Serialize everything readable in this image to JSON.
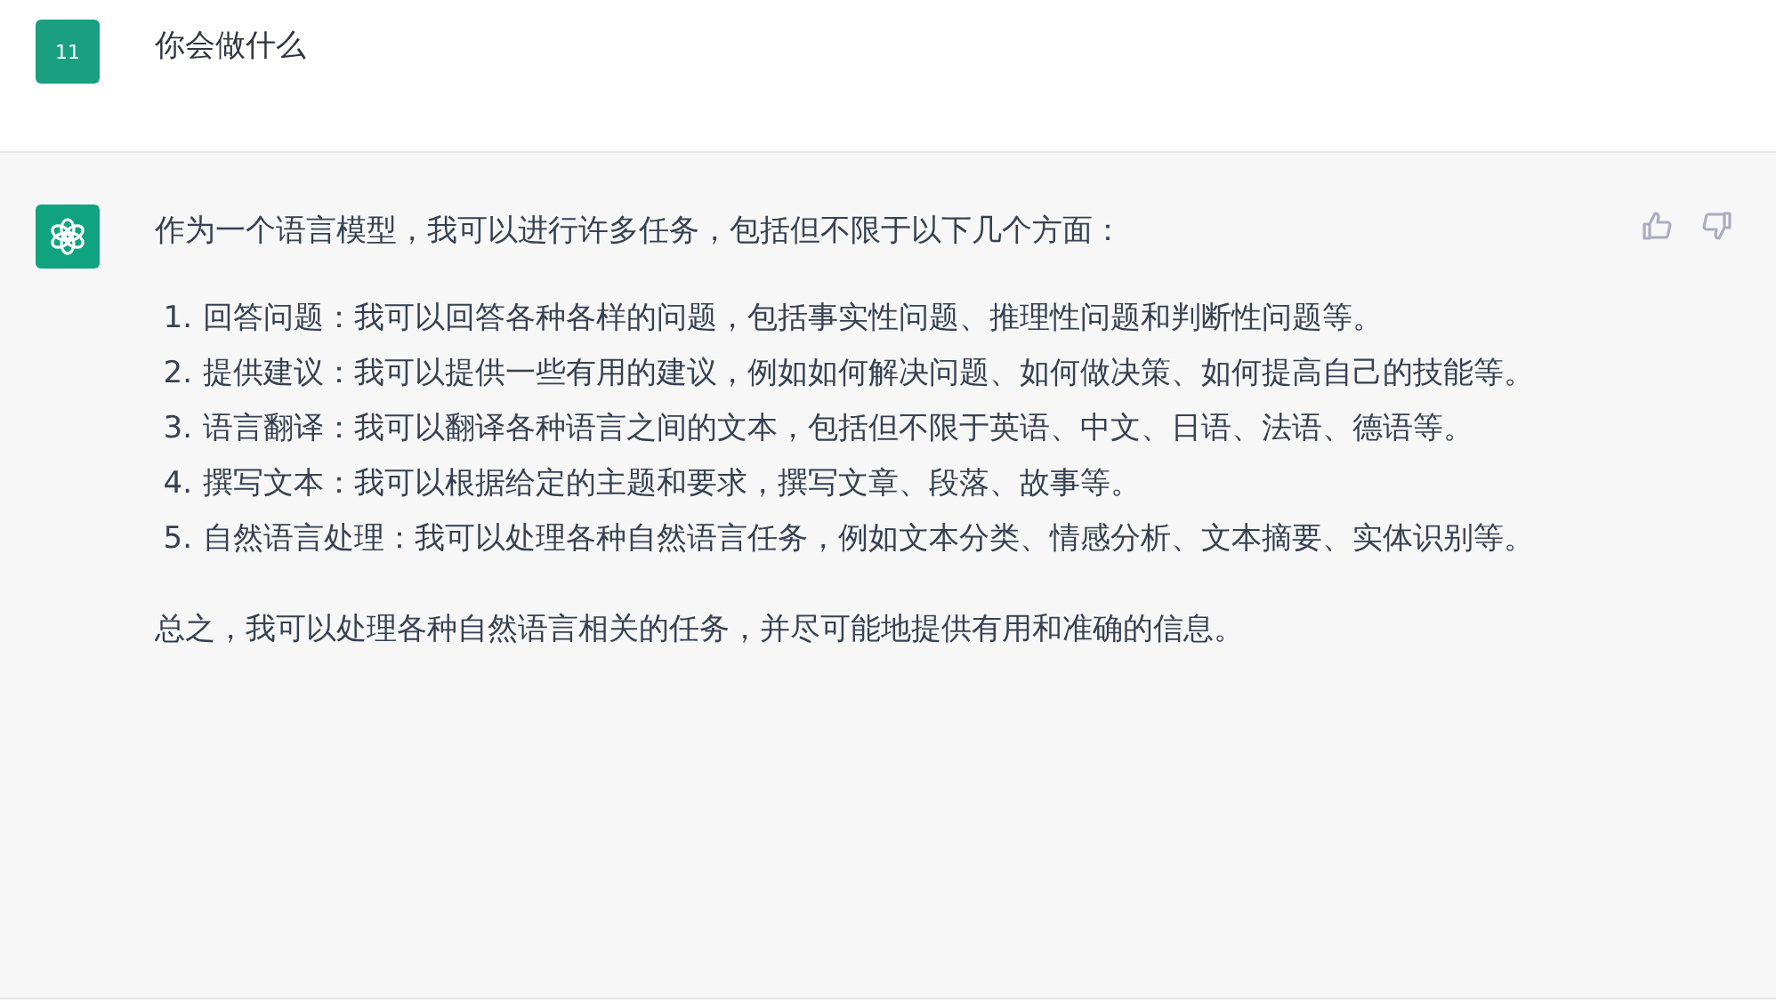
{
  "user_message": {
    "avatar": "11",
    "text": "你会做什么"
  },
  "assistant_message": {
    "intro": "作为一个语言模型，我可以进行许多任务，包括但不限于以下几个方面：",
    "items": [
      {
        "number": "1.",
        "text": "回答问题：我可以回答各种各样的问题，包括事实性问题、推理性问题和判断性问题等。"
      },
      {
        "number": "2.",
        "text": "提供建议：我可以提供一些有用的建议，例如如何解决问题、如何做决策、如何提高自己的技能等。"
      },
      {
        "number": "3.",
        "text": "语言翻译：我可以翻译各种语言之间的文本，包括但不限于英语、中文、日语、法语、德语等。"
      },
      {
        "number": "4.",
        "text": "撰写文本：我可以根据给定的主题和要求，撰写文章、段落、故事等。"
      },
      {
        "number": "5.",
        "text": "自然语言处理：我可以处理各种自然语言任务，例如文本分类、情感分析、文本摘要、实体识别等。"
      }
    ],
    "conclusion": "总之，我可以处理各种自然语言相关的任务，并尽可能地提供有用和准确的信息。"
  }
}
